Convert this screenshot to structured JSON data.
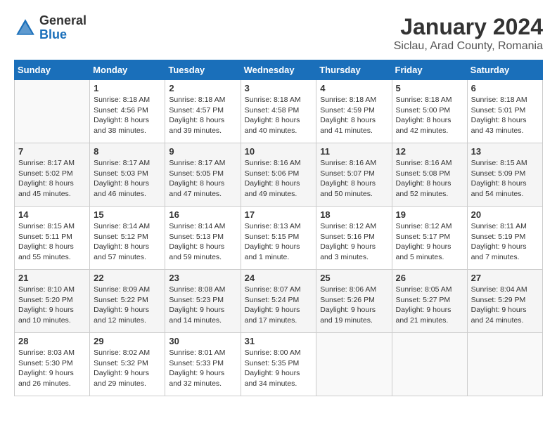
{
  "header": {
    "logo_general": "General",
    "logo_blue": "Blue",
    "title": "January 2024",
    "subtitle": "Siclau, Arad County, Romania"
  },
  "calendar": {
    "days_of_week": [
      "Sunday",
      "Monday",
      "Tuesday",
      "Wednesday",
      "Thursday",
      "Friday",
      "Saturday"
    ],
    "weeks": [
      [
        {
          "day": "",
          "info": ""
        },
        {
          "day": "1",
          "info": "Sunrise: 8:18 AM\nSunset: 4:56 PM\nDaylight: 8 hours\nand 38 minutes."
        },
        {
          "day": "2",
          "info": "Sunrise: 8:18 AM\nSunset: 4:57 PM\nDaylight: 8 hours\nand 39 minutes."
        },
        {
          "day": "3",
          "info": "Sunrise: 8:18 AM\nSunset: 4:58 PM\nDaylight: 8 hours\nand 40 minutes."
        },
        {
          "day": "4",
          "info": "Sunrise: 8:18 AM\nSunset: 4:59 PM\nDaylight: 8 hours\nand 41 minutes."
        },
        {
          "day": "5",
          "info": "Sunrise: 8:18 AM\nSunset: 5:00 PM\nDaylight: 8 hours\nand 42 minutes."
        },
        {
          "day": "6",
          "info": "Sunrise: 8:18 AM\nSunset: 5:01 PM\nDaylight: 8 hours\nand 43 minutes."
        }
      ],
      [
        {
          "day": "7",
          "info": "Sunrise: 8:17 AM\nSunset: 5:02 PM\nDaylight: 8 hours\nand 45 minutes."
        },
        {
          "day": "8",
          "info": "Sunrise: 8:17 AM\nSunset: 5:03 PM\nDaylight: 8 hours\nand 46 minutes."
        },
        {
          "day": "9",
          "info": "Sunrise: 8:17 AM\nSunset: 5:05 PM\nDaylight: 8 hours\nand 47 minutes."
        },
        {
          "day": "10",
          "info": "Sunrise: 8:16 AM\nSunset: 5:06 PM\nDaylight: 8 hours\nand 49 minutes."
        },
        {
          "day": "11",
          "info": "Sunrise: 8:16 AM\nSunset: 5:07 PM\nDaylight: 8 hours\nand 50 minutes."
        },
        {
          "day": "12",
          "info": "Sunrise: 8:16 AM\nSunset: 5:08 PM\nDaylight: 8 hours\nand 52 minutes."
        },
        {
          "day": "13",
          "info": "Sunrise: 8:15 AM\nSunset: 5:09 PM\nDaylight: 8 hours\nand 54 minutes."
        }
      ],
      [
        {
          "day": "14",
          "info": "Sunrise: 8:15 AM\nSunset: 5:11 PM\nDaylight: 8 hours\nand 55 minutes."
        },
        {
          "day": "15",
          "info": "Sunrise: 8:14 AM\nSunset: 5:12 PM\nDaylight: 8 hours\nand 57 minutes."
        },
        {
          "day": "16",
          "info": "Sunrise: 8:14 AM\nSunset: 5:13 PM\nDaylight: 8 hours\nand 59 minutes."
        },
        {
          "day": "17",
          "info": "Sunrise: 8:13 AM\nSunset: 5:15 PM\nDaylight: 9 hours\nand 1 minute."
        },
        {
          "day": "18",
          "info": "Sunrise: 8:12 AM\nSunset: 5:16 PM\nDaylight: 9 hours\nand 3 minutes."
        },
        {
          "day": "19",
          "info": "Sunrise: 8:12 AM\nSunset: 5:17 PM\nDaylight: 9 hours\nand 5 minutes."
        },
        {
          "day": "20",
          "info": "Sunrise: 8:11 AM\nSunset: 5:19 PM\nDaylight: 9 hours\nand 7 minutes."
        }
      ],
      [
        {
          "day": "21",
          "info": "Sunrise: 8:10 AM\nSunset: 5:20 PM\nDaylight: 9 hours\nand 10 minutes."
        },
        {
          "day": "22",
          "info": "Sunrise: 8:09 AM\nSunset: 5:22 PM\nDaylight: 9 hours\nand 12 minutes."
        },
        {
          "day": "23",
          "info": "Sunrise: 8:08 AM\nSunset: 5:23 PM\nDaylight: 9 hours\nand 14 minutes."
        },
        {
          "day": "24",
          "info": "Sunrise: 8:07 AM\nSunset: 5:24 PM\nDaylight: 9 hours\nand 17 minutes."
        },
        {
          "day": "25",
          "info": "Sunrise: 8:06 AM\nSunset: 5:26 PM\nDaylight: 9 hours\nand 19 minutes."
        },
        {
          "day": "26",
          "info": "Sunrise: 8:05 AM\nSunset: 5:27 PM\nDaylight: 9 hours\nand 21 minutes."
        },
        {
          "day": "27",
          "info": "Sunrise: 8:04 AM\nSunset: 5:29 PM\nDaylight: 9 hours\nand 24 minutes."
        }
      ],
      [
        {
          "day": "28",
          "info": "Sunrise: 8:03 AM\nSunset: 5:30 PM\nDaylight: 9 hours\nand 26 minutes."
        },
        {
          "day": "29",
          "info": "Sunrise: 8:02 AM\nSunset: 5:32 PM\nDaylight: 9 hours\nand 29 minutes."
        },
        {
          "day": "30",
          "info": "Sunrise: 8:01 AM\nSunset: 5:33 PM\nDaylight: 9 hours\nand 32 minutes."
        },
        {
          "day": "31",
          "info": "Sunrise: 8:00 AM\nSunset: 5:35 PM\nDaylight: 9 hours\nand 34 minutes."
        },
        {
          "day": "",
          "info": ""
        },
        {
          "day": "",
          "info": ""
        },
        {
          "day": "",
          "info": ""
        }
      ]
    ]
  }
}
